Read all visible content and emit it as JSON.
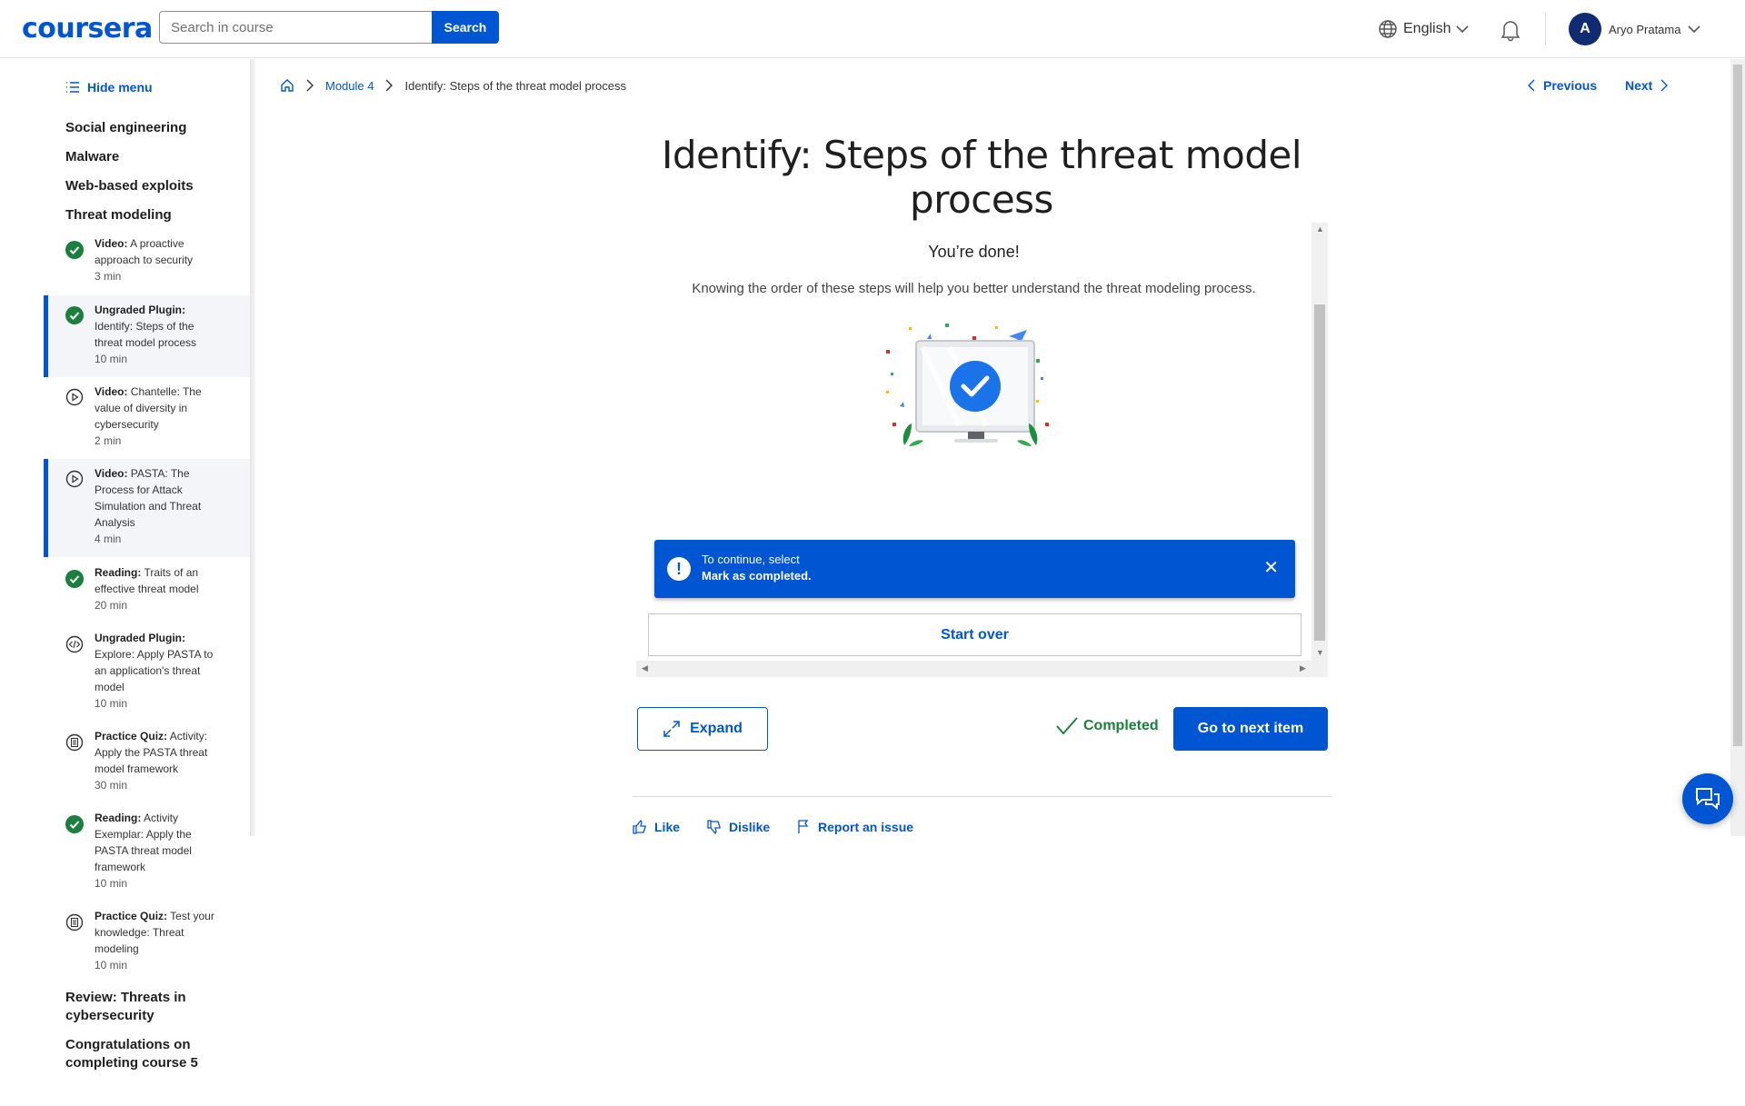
{
  "header": {
    "logo": "coursera",
    "search_placeholder": "Search in course",
    "search_button": "Search",
    "language": "English",
    "user_initial": "A",
    "user_name": "Aryo Pratama"
  },
  "sidebar": {
    "hide_menu": "Hide menu",
    "sections": [
      "Social engineering",
      "Malware",
      "Web-based exploits",
      "Threat modeling"
    ],
    "items": [
      {
        "type": "Video:",
        "title": "A proactive approach to security",
        "duration": "3 min",
        "status": "completed"
      },
      {
        "type": "Ungraded Plugin:",
        "title": "Identify: Steps of the threat model process",
        "duration": "10 min",
        "status": "completed"
      },
      {
        "type": "Video:",
        "title": "Chantelle: The value of diversity in cybersecurity",
        "duration": "2 min",
        "status": "video"
      },
      {
        "type": "Video:",
        "title": "PASTA: The Process for Attack Simulation and Threat Analysis",
        "duration": "4 min",
        "status": "video"
      },
      {
        "type": "Reading:",
        "title": "Traits of an effective threat model",
        "duration": "20 min",
        "status": "completed"
      },
      {
        "type": "Ungraded Plugin:",
        "title": "Explore: Apply PASTA to an application's threat model",
        "duration": "10 min",
        "status": "code"
      },
      {
        "type": "Practice Quiz:",
        "title": "Activity: Apply the PASTA threat model framework",
        "duration": "30 min",
        "status": "quiz"
      },
      {
        "type": "Reading:",
        "title": "Activity Exemplar: Apply the PASTA threat model framework",
        "duration": "10 min",
        "status": "completed"
      },
      {
        "type": "Practice Quiz:",
        "title": "Test your knowledge: Threat modeling",
        "duration": "10 min",
        "status": "quiz"
      }
    ],
    "bottom_sections": [
      "Review: Threats in cybersecurity",
      "Congratulations on completing course 5"
    ]
  },
  "breadcrumb": {
    "module": "Module 4",
    "current": "Identify: Steps of the threat model process"
  },
  "nav": {
    "previous": "Previous",
    "next": "Next"
  },
  "main": {
    "title": "Identify: Steps of the threat model process",
    "done_title": "You’re done!",
    "done_description": "Knowing the order of these steps will help you better understand the threat modeling process.",
    "toast_line1": "To continue, select",
    "toast_line2": "Mark as completed.",
    "start_over": "Start over",
    "expand": "Expand",
    "completed": "Completed",
    "go_next": "Go to next item",
    "like": "Like",
    "dislike": "Dislike",
    "report": "Report an issue"
  },
  "colors": {
    "accent": "#0056d2",
    "success": "#1b7f3e"
  }
}
